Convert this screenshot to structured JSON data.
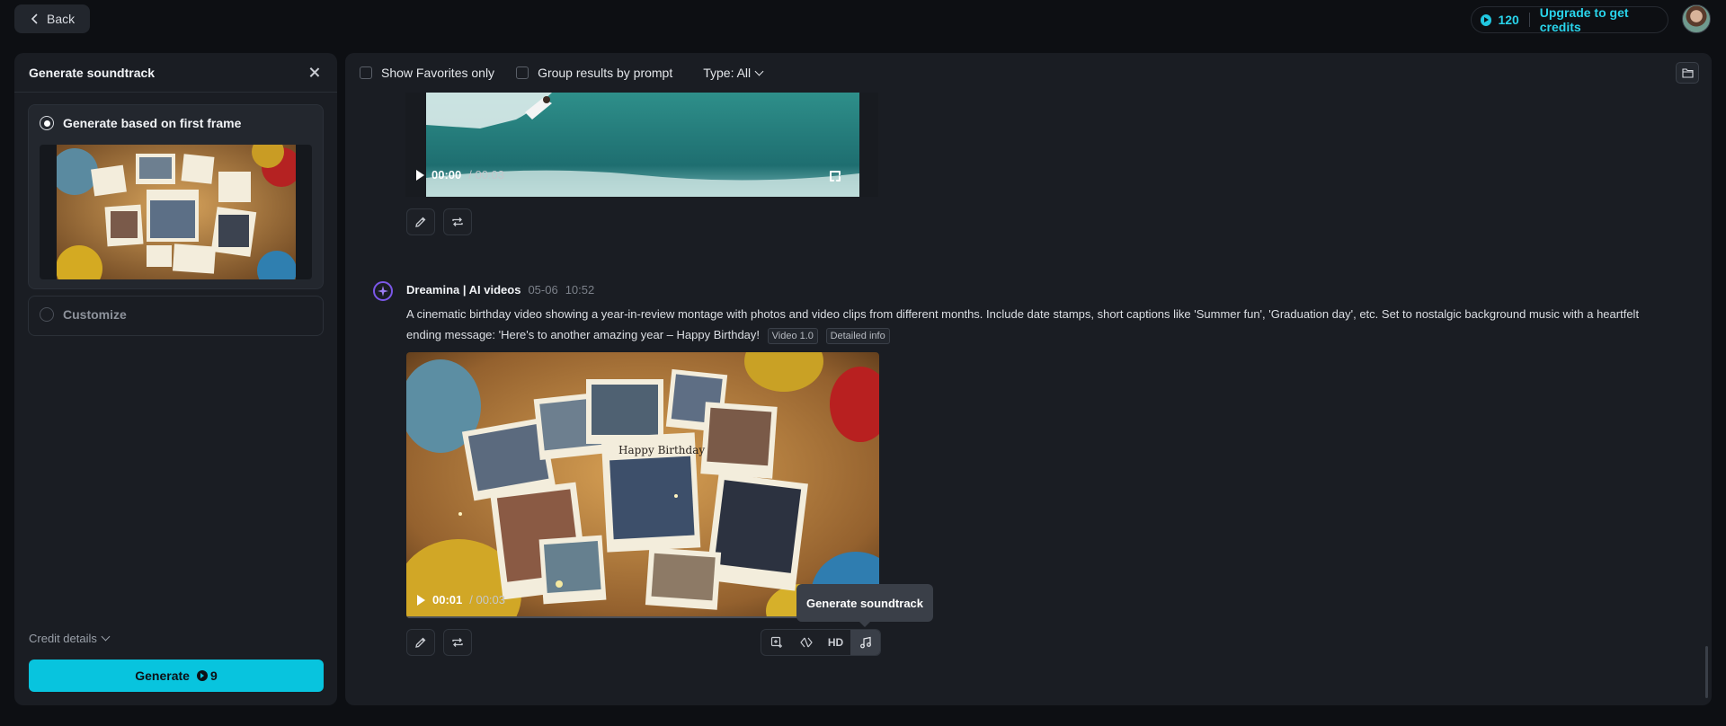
{
  "topbar": {
    "back_label": "Back",
    "credits": "120",
    "upgrade_label": "Upgrade to get credits"
  },
  "left_panel": {
    "title": "Generate soundtrack",
    "option_first_frame": "Generate based on first frame",
    "option_customize": "Customize",
    "credit_details": "Credit details",
    "generate_label": "Generate",
    "generate_cost": "9"
  },
  "toolbar": {
    "favorites_label": "Show Favorites only",
    "group_label": "Group results by prompt",
    "type_label": "Type: All"
  },
  "video1": {
    "current": "00:00",
    "duration": "/ 00:03"
  },
  "entry": {
    "author": "Dreamina | AI videos",
    "date": "05-06",
    "time": "10:52",
    "prompt": "A cinematic birthday video showing a year-in-review montage with photos and video clips from different months. Include date stamps, short captions like 'Summer fun', 'Graduation day', etc. Set to nostalgic background music with a heartfelt ending message: 'Here's to another amazing year – Happy Birthday!",
    "tag_model": "Video 1.0",
    "tag_info": "Detailed info"
  },
  "video2": {
    "current": "00:01",
    "duration": "/ 00:03",
    "caption": "Happy Birthday"
  },
  "actions": {
    "hd_label": "HD"
  },
  "tooltip": "Generate soundtrack",
  "colors": {
    "accent": "#08c4de",
    "background": "#0d0f13",
    "panel": "#1a1d23",
    "bot_purple": "#7b57e8"
  }
}
